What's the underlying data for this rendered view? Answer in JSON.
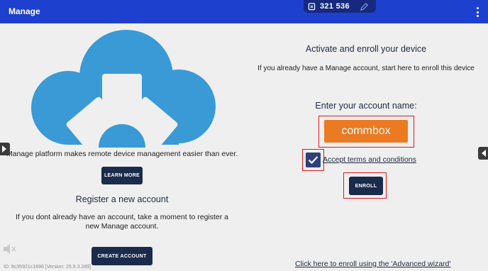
{
  "appbar": {
    "title": "Manage",
    "menu_icon": "more-vert-icon"
  },
  "device_pill": {
    "number": "321 536",
    "left_icon": "device-link-icon",
    "right_icon": "edit-pencil-icon"
  },
  "left_panel": {
    "logo_icon": "cloud-gear-icon",
    "tagline": "Manage platform makes remote device management easier than ever.",
    "learn_more_label": "LEARN MORE",
    "register_title": "Register a new account",
    "register_description": "If you dont already have an account, take a moment to register a new Manage account.",
    "create_account_label": "CREATE ACCOUNT"
  },
  "right_panel": {
    "activate_title": "Activate and enroll your device",
    "activate_description": "If you already have a Manage account, start here to enroll this device",
    "account_label": "Enter your account name:",
    "account_value": "commbox",
    "terms_checked": true,
    "terms_label": "Accept terms and conditions",
    "enroll_label": "ENROLL",
    "advanced_link": "Click here to enroll using the 'Advanced wizard'"
  },
  "footer": {
    "id_text": "ID: 8c35921c1696 [Version: 25.9.3.289]"
  },
  "colors": {
    "appbar": "#1e40cf",
    "pill": "#16297f",
    "cloud": "#3a9ad6",
    "button": "#1a2b4c",
    "input": "#eb7a23",
    "highlight": "#e0191e"
  }
}
